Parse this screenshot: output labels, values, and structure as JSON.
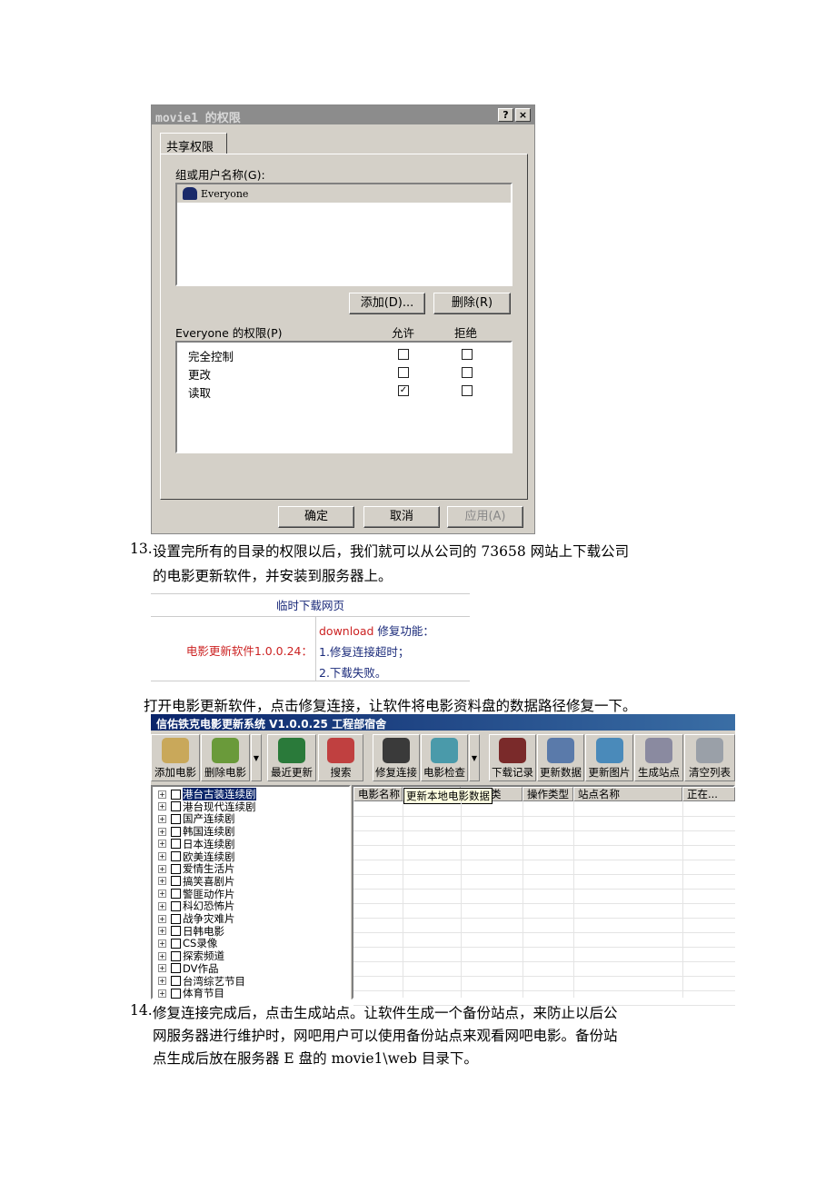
{
  "dialog": {
    "title": "movie1 的权限",
    "help_button": "?",
    "close_button": "×",
    "tab": "共享权限",
    "group_label": "组或用户名称(G):",
    "users": [
      "Everyone"
    ],
    "add_button": "添加(D)...",
    "remove_button": "删除(R)",
    "permissions_label": "Everyone 的权限(P)",
    "allow_header": "允许",
    "deny_header": "拒绝",
    "permissions": [
      {
        "name": "完全控制",
        "allow": false,
        "deny": false
      },
      {
        "name": "更改",
        "allow": false,
        "deny": false
      },
      {
        "name": "读取",
        "allow": true,
        "deny": false
      }
    ],
    "ok_button": "确定",
    "cancel_button": "取消",
    "apply_button": "应用(A)"
  },
  "doc": {
    "step13_num": "13.",
    "step13_line1": "设置完所有的目录的权限以后，我们就可以从公司的 73658 网站上下载公司",
    "step13_line2": "的电影更新软件，并安装到服务器上。",
    "para_open": "打开电影更新软件，点击修复连接，让软件将电影资料盘的数据路径修复一下。",
    "step14_num": "14.",
    "step14_line1": "修复连接完成后，点击生成站点。让软件生成一个备份站点，来防止以后公",
    "step14_line2": "网服务器进行维护时，网吧用户可以使用备份站点来观看网吧电影。备份站",
    "step14_line3": "点生成后放在服务器 E 盘的 movie1\\web 目录下。"
  },
  "web": {
    "header": "临时下载网页",
    "software": "电影更新软件1.0.0.24：",
    "fix_prefix": "download",
    "fix_title": " 修复功能：",
    "fix1": "1.修复连接超时；",
    "fix2": "2.下载失败。",
    "colors": {
      "red": "#cc2222",
      "blue": "#1a2a7a"
    }
  },
  "app": {
    "title": "信佑铁克电影更新系统 V1.0.0.25    工程部宿舍",
    "toolbar": [
      "添加电影",
      "删除电影",
      "最近更新",
      "搜索",
      "修复连接",
      "电影检查",
      "下载记录",
      "更新数据",
      "更新图片",
      "生成站点",
      "清空列表"
    ],
    "categories": [
      "港台古装连续剧",
      "港台现代连续剧",
      "国产连续剧",
      "韩国连续剧",
      "日本连续剧",
      "欧美连续剧",
      "爱情生活片",
      "搞笑喜剧片",
      "警匪动作片",
      "科幻恐怖片",
      "战争灾难片",
      "日韩电影",
      "CS录像",
      "探索频道",
      "DV作品",
      "台湾综艺节目",
      "体育节目"
    ],
    "columns": {
      "name": "电影名称",
      "type": "类",
      "op": "操作类型",
      "site": "站点名称",
      "status": "正在..."
    },
    "tooltip": "更新本地电影数据"
  }
}
